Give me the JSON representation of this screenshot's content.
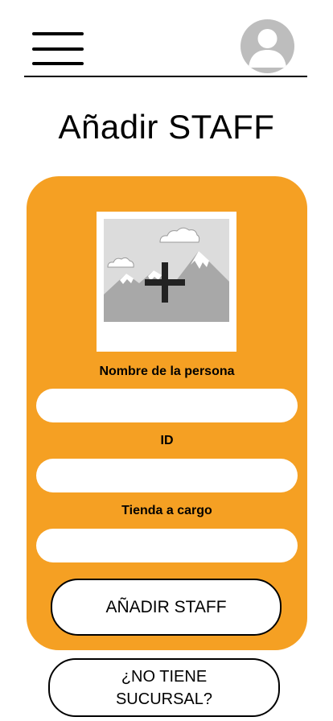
{
  "header": {
    "menu_icon": "hamburger-menu-icon",
    "avatar_icon": "user-avatar-icon"
  },
  "page": {
    "title": "Añadir STAFF"
  },
  "form": {
    "photo_icon": "add-image-icon",
    "fields": [
      {
        "label": "Nombre de la persona",
        "value": "",
        "placeholder": ""
      },
      {
        "label": "ID",
        "value": "",
        "placeholder": ""
      },
      {
        "label": "Tienda a cargo",
        "value": "",
        "placeholder": ""
      }
    ],
    "submit_label": "AÑADIR STAFF"
  },
  "secondary": {
    "line1": "¿NO TIENE",
    "line2": "SUCURSAL?"
  },
  "colors": {
    "card": "#f5a023",
    "input_bg": "#ffffff",
    "text": "#000000",
    "avatar": "#bdbdbd"
  }
}
